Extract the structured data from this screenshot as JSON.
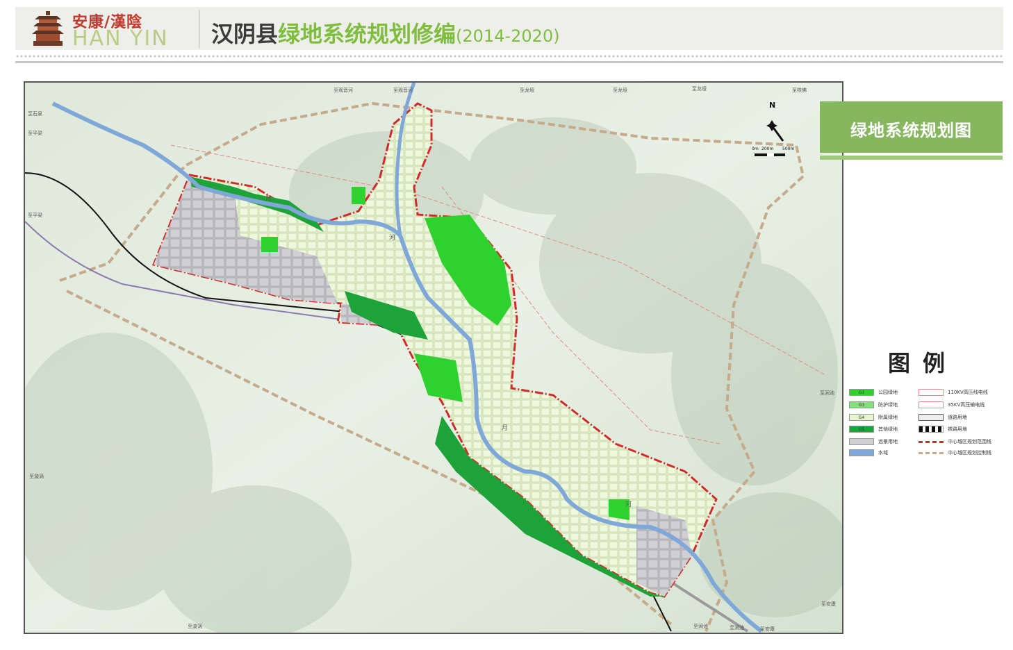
{
  "header": {
    "logo_cn": "安康/漢陰",
    "logo_en": "HAN YIN",
    "title_black": "汉阴县",
    "title_green": "绿地系统规划修编",
    "title_years": "(2014-2020)"
  },
  "panel": {
    "title": "绿地系统规划图"
  },
  "compass": {
    "north": "N",
    "scale_0": "0m",
    "scale_1": "200m",
    "scale_2": "500m"
  },
  "legend": {
    "title": "图例",
    "items_left": [
      {
        "code": "G1",
        "label": "公园绿地",
        "color": "#2fd12f"
      },
      {
        "code": "G3",
        "label": "防护绿地",
        "color": "#7fe27a"
      },
      {
        "code": "G4",
        "label": "附属绿地",
        "color": "#e5f5cd"
      },
      {
        "code": "G5",
        "label": "其他绿地",
        "color": "#1ea23a"
      },
      {
        "code": "",
        "label": "远景用地",
        "color": "#cfcfd4"
      },
      {
        "code": "",
        "label": "水域",
        "color": "#7fa7d8"
      }
    ],
    "items_right": [
      {
        "label": "110KV高压线电线"
      },
      {
        "label": "35KV高压输电线"
      },
      {
        "label": "道路用地"
      },
      {
        "label": "铁路用地"
      },
      {
        "label": "中心城区规划范围线"
      },
      {
        "label": "中心城区规划控制线"
      }
    ]
  },
  "map_labels": {
    "top": [
      "至观音河",
      "至观音河",
      "至龙垭",
      "至龙垭",
      "至龙垭",
      "至铁佛"
    ],
    "left": [
      "至石泉",
      "至平梁",
      "至平梁",
      "至漩涡"
    ],
    "bottom": [
      "至漩涡",
      "至涧池",
      "至涧池",
      "至安康"
    ],
    "right": [
      "至涧池",
      "至安康"
    ],
    "river": [
      "月",
      "河",
      "月",
      "河"
    ]
  }
}
